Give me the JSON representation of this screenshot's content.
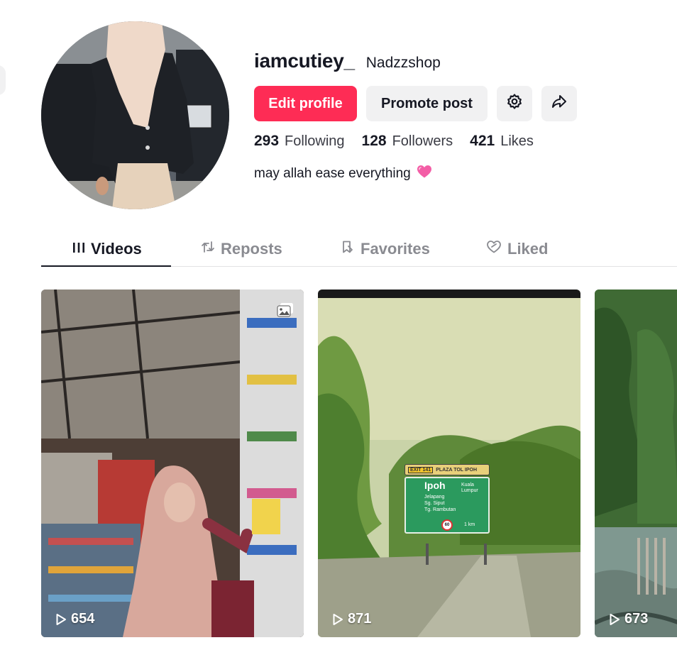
{
  "profile": {
    "username": "iamcutiey_",
    "nickname": "Nadzzshop",
    "bio": "may allah ease everything",
    "bio_emoji": "pink-heart-icon"
  },
  "actions": {
    "edit_profile": "Edit profile",
    "promote_post": "Promote post",
    "settings_icon": "gear-icon",
    "share_icon": "share-icon"
  },
  "stats": [
    {
      "value": "293",
      "label": "Following"
    },
    {
      "value": "128",
      "label": "Followers"
    },
    {
      "value": "421",
      "label": "Likes"
    }
  ],
  "tabs": [
    {
      "label": "Videos",
      "icon": "grid-bars-icon",
      "active": true
    },
    {
      "label": "Reposts",
      "icon": "repost-icon",
      "active": false
    },
    {
      "label": "Favorites",
      "icon": "bookmark-icon",
      "active": false
    },
    {
      "label": "Liked",
      "icon": "heart-outline-icon",
      "active": false
    }
  ],
  "videos": [
    {
      "views": "654",
      "type": "photo"
    },
    {
      "views": "871",
      "type": "video"
    },
    {
      "views": "673",
      "type": "video"
    }
  ],
  "road_sign": {
    "exit": "EXIT 141",
    "plaza": "PLAZA TOL IPOH",
    "main": "Ipoh",
    "side": "Kuala Lumpur",
    "towns": [
      "Jelapang",
      "Sg. Siput",
      "Tg. Rambutan"
    ],
    "distance": "1 km",
    "speed": "60"
  },
  "colors": {
    "accent": "#fe2c55",
    "secondary_bg": "#f1f1f2",
    "text": "#161823",
    "muted": "#8a8b91"
  }
}
